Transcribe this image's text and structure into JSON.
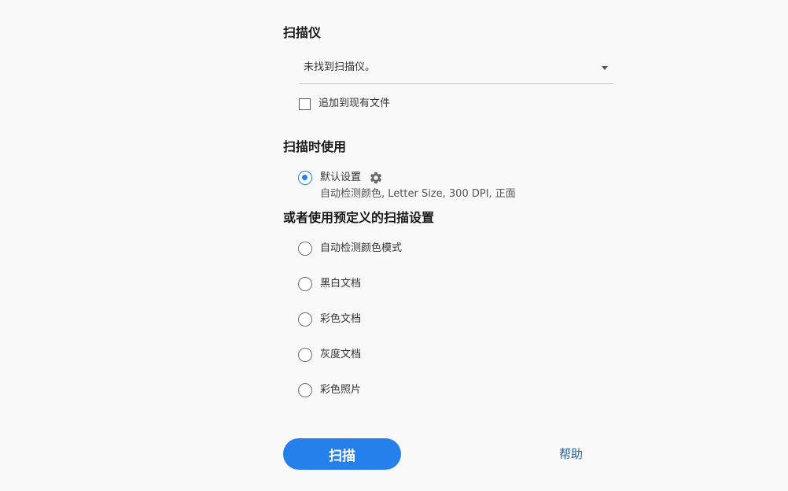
{
  "scanner_section": {
    "title": "扫描仪",
    "dropdown_value": "未找到扫描仪。",
    "append_checkbox_label": "追加到现有文件",
    "append_checked": false
  },
  "scan_using_section": {
    "title": "扫描时使用",
    "default_option": {
      "label": "默认设置",
      "description": "自动检测颜色, Letter Size, 300 DPI, 正面",
      "selected": true,
      "settings_icon": "gear-icon"
    }
  },
  "preset_section": {
    "title": "或者使用预定义的扫描设置",
    "options": [
      {
        "label": "自动检测颜色模式",
        "selected": false
      },
      {
        "label": "黑白文档",
        "selected": false
      },
      {
        "label": "彩色文档",
        "selected": false
      },
      {
        "label": "灰度文档",
        "selected": false
      },
      {
        "label": "彩色照片",
        "selected": false
      }
    ]
  },
  "actions": {
    "scan_label": "扫描",
    "help_label": "帮助"
  },
  "colors": {
    "accent": "#2680eb",
    "link": "#1f5fa8",
    "background": "#f9f9f9"
  }
}
